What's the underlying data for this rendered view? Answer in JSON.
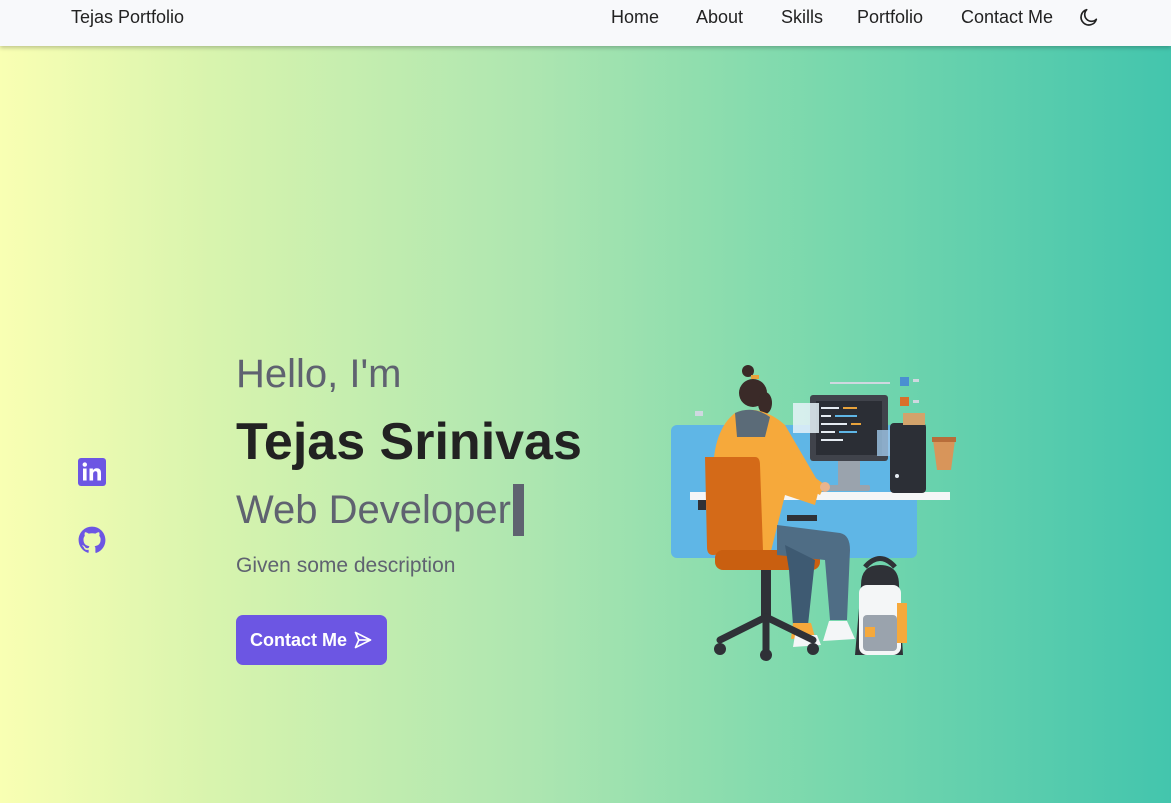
{
  "navbar": {
    "brand": "Tejas Portfolio",
    "links": [
      "Home",
      "About",
      "Skills",
      "Portfolio",
      "Contact Me"
    ],
    "theme_icon": "moon-icon"
  },
  "social": [
    {
      "name": "linkedin-icon"
    },
    {
      "name": "github-icon"
    }
  ],
  "hero": {
    "greeting": "Hello, I'm",
    "name": "Tejas Srinivas",
    "role": "Web Developer",
    "description": "Given some description",
    "button_label": "Contact Me",
    "button_icon": "send-icon"
  },
  "colors": {
    "accent": "#6c56e3",
    "text_dark": "#222222",
    "text_muted": "#5f6270",
    "gradient_start": "#f9ffb3",
    "gradient_end": "#43c5ad"
  },
  "illustration": "developer-at-desk-illustration"
}
